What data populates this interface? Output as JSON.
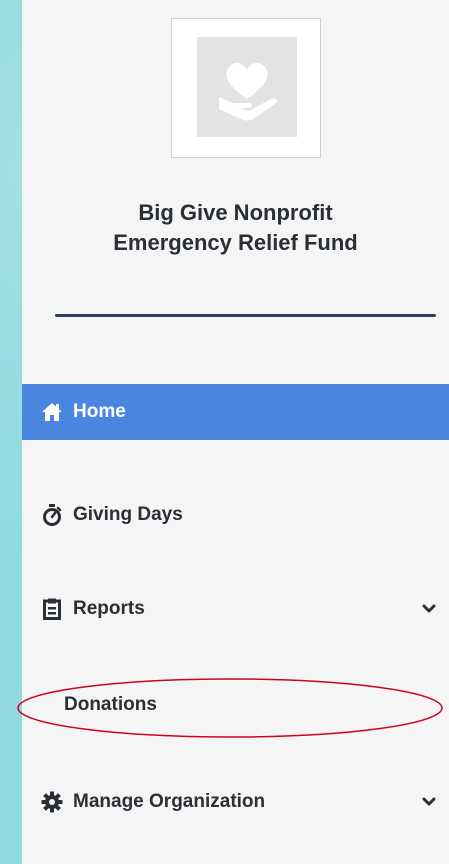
{
  "organization": {
    "name_line1": "Big Give Nonprofit",
    "name_line2": "Emergency Relief Fund",
    "logo_icon": "heart-hand-icon"
  },
  "nav": {
    "home": {
      "label": "Home",
      "icon": "home-icon",
      "active": true
    },
    "giving_days": {
      "label": "Giving Days",
      "icon": "stopwatch-icon"
    },
    "reports": {
      "label": "Reports",
      "icon": "clipboard-icon",
      "expand_icon": "chevron-down-icon",
      "sub_items": [
        {
          "label": "Donations"
        }
      ]
    },
    "manage_organization": {
      "label": "Manage Organization",
      "icon": "gear-icon",
      "expand_icon": "chevron-down-icon"
    }
  },
  "colors": {
    "active_bg": "#4a86e0",
    "sidebar_bg": "#f5f5f5",
    "text": "#2a2f36",
    "divider": "#2c3e5c",
    "annotation": "#d0021b",
    "page_bg": "#8fd9de"
  }
}
